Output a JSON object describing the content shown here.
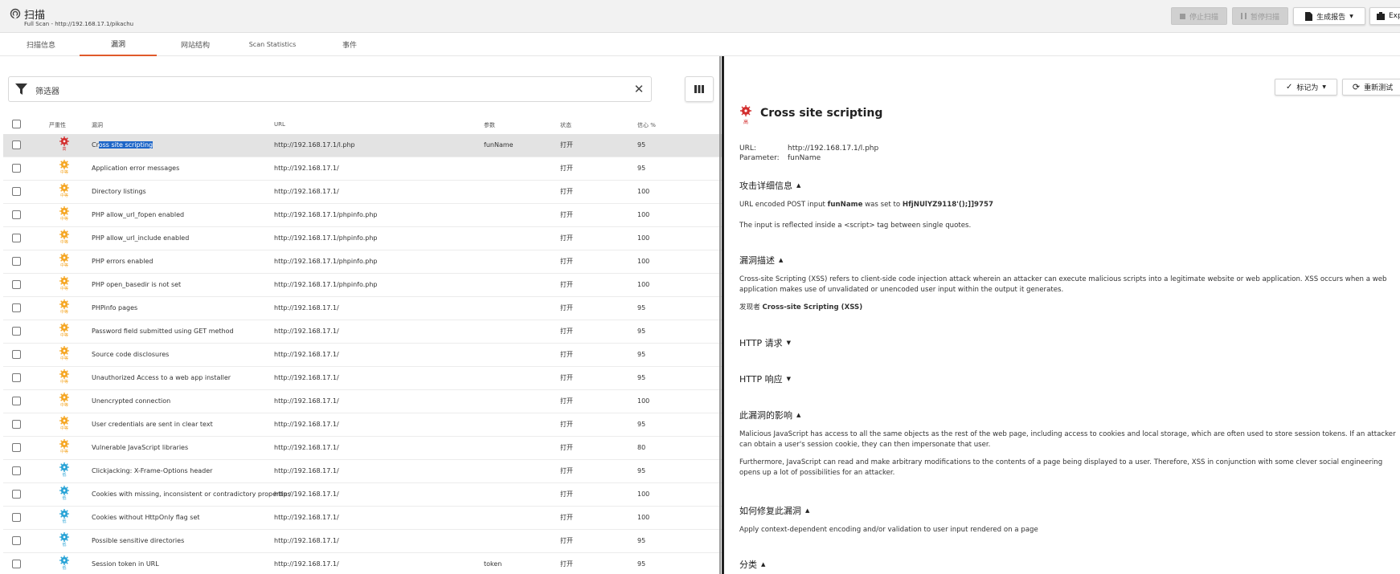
{
  "header": {
    "title": "扫描",
    "subtitle": "Full Scan - http://192.168.17.1/pikachu",
    "stop_label": "停止扫描",
    "pause_label": "暂停扫描",
    "report_label": "生成报告",
    "export_label": "Exp"
  },
  "tabs": [
    {
      "label": "扫描信息"
    },
    {
      "label": "漏洞"
    },
    {
      "label": "网站结构"
    },
    {
      "label": "Scan Statistics"
    },
    {
      "label": "事件"
    }
  ],
  "filter": {
    "label": "筛选器"
  },
  "columns": {
    "severity": "严重性",
    "vuln": "漏洞",
    "url": "URL",
    "param": "参数",
    "status": "状态",
    "confidence": "信心 %"
  },
  "severity_colors": {
    "high": "#d32f2f",
    "medium": "#f5a623",
    "low": "#29a3d6"
  },
  "rows": [
    {
      "sev": "high",
      "sev_label": "高",
      "name_pre": "Cr",
      "name_hl": "oss site scripting",
      "url": "http://192.168.17.1/l.php",
      "param": "funName",
      "status": "打开",
      "confidence": "95"
    },
    {
      "sev": "medium",
      "sev_label": "中等",
      "name_pre": "Application error messages",
      "name_hl": "",
      "url": "http://192.168.17.1/",
      "param": "",
      "status": "打开",
      "confidence": "95"
    },
    {
      "sev": "medium",
      "sev_label": "中等",
      "name_pre": "Directory listings",
      "name_hl": "",
      "url": "http://192.168.17.1/",
      "param": "",
      "status": "打开",
      "confidence": "100"
    },
    {
      "sev": "medium",
      "sev_label": "中等",
      "name_pre": "PHP allow_url_fopen enabled",
      "name_hl": "",
      "url": "http://192.168.17.1/phpinfo.php",
      "param": "",
      "status": "打开",
      "confidence": "100"
    },
    {
      "sev": "medium",
      "sev_label": "中等",
      "name_pre": "PHP allow_url_include enabled",
      "name_hl": "",
      "url": "http://192.168.17.1/phpinfo.php",
      "param": "",
      "status": "打开",
      "confidence": "100"
    },
    {
      "sev": "medium",
      "sev_label": "中等",
      "name_pre": "PHP errors enabled",
      "name_hl": "",
      "url": "http://192.168.17.1/phpinfo.php",
      "param": "",
      "status": "打开",
      "confidence": "100"
    },
    {
      "sev": "medium",
      "sev_label": "中等",
      "name_pre": "PHP open_basedir is not set",
      "name_hl": "",
      "url": "http://192.168.17.1/phpinfo.php",
      "param": "",
      "status": "打开",
      "confidence": "100"
    },
    {
      "sev": "medium",
      "sev_label": "中等",
      "name_pre": "PHPinfo pages",
      "name_hl": "",
      "url": "http://192.168.17.1/",
      "param": "",
      "status": "打开",
      "confidence": "95"
    },
    {
      "sev": "medium",
      "sev_label": "中等",
      "name_pre": "Password field submitted using GET method",
      "name_hl": "",
      "url": "http://192.168.17.1/",
      "param": "",
      "status": "打开",
      "confidence": "95"
    },
    {
      "sev": "medium",
      "sev_label": "中等",
      "name_pre": "Source code disclosures",
      "name_hl": "",
      "url": "http://192.168.17.1/",
      "param": "",
      "status": "打开",
      "confidence": "95"
    },
    {
      "sev": "medium",
      "sev_label": "中等",
      "name_pre": "Unauthorized Access to a web app installer",
      "name_hl": "",
      "url": "http://192.168.17.1/",
      "param": "",
      "status": "打开",
      "confidence": "95"
    },
    {
      "sev": "medium",
      "sev_label": "中等",
      "name_pre": "Unencrypted connection",
      "name_hl": "",
      "url": "http://192.168.17.1/",
      "param": "",
      "status": "打开",
      "confidence": "100"
    },
    {
      "sev": "medium",
      "sev_label": "中等",
      "name_pre": "User credentials are sent in clear text",
      "name_hl": "",
      "url": "http://192.168.17.1/",
      "param": "",
      "status": "打开",
      "confidence": "95"
    },
    {
      "sev": "medium",
      "sev_label": "中等",
      "name_pre": "Vulnerable JavaScript libraries",
      "name_hl": "",
      "url": "http://192.168.17.1/",
      "param": "",
      "status": "打开",
      "confidence": "80"
    },
    {
      "sev": "low",
      "sev_label": "低",
      "name_pre": "Clickjacking: X-Frame-Options header",
      "name_hl": "",
      "url": "http://192.168.17.1/",
      "param": "",
      "status": "打开",
      "confidence": "95"
    },
    {
      "sev": "low",
      "sev_label": "低",
      "name_pre": "Cookies with missing, inconsistent or contradictory properties",
      "name_hl": "",
      "url": "http://192.168.17.1/",
      "param": "",
      "status": "打开",
      "confidence": "100"
    },
    {
      "sev": "low",
      "sev_label": "低",
      "name_pre": "Cookies without HttpOnly flag set",
      "name_hl": "",
      "url": "http://192.168.17.1/",
      "param": "",
      "status": "打开",
      "confidence": "100"
    },
    {
      "sev": "low",
      "sev_label": "低",
      "name_pre": "Possible sensitive directories",
      "name_hl": "",
      "url": "http://192.168.17.1/",
      "param": "",
      "status": "打开",
      "confidence": "95"
    },
    {
      "sev": "low",
      "sev_label": "低",
      "name_pre": "Session token in URL",
      "name_hl": "",
      "url": "http://192.168.17.1/",
      "param": "token",
      "status": "打开",
      "confidence": "95"
    }
  ],
  "detail": {
    "mark_label": "标记为",
    "retest_label": "重新测试",
    "title": "Cross site scripting",
    "sev_label": "高",
    "url_label": "URL:",
    "url_value": "http://192.168.17.1/l.php",
    "param_label": "Parameter:",
    "param_value": "funName",
    "attack_title": "攻击详细信息",
    "attack_pre": "URL encoded POST input ",
    "attack_bold1": "funName",
    "attack_mid": " was set to ",
    "attack_bold2": "HfjNUlYZ9118'();]]9757",
    "attack_note": "The input is reflected inside a <script> tag between single quotes.",
    "desc_title": "漏洞描述",
    "desc_text": "Cross-site Scripting (XSS) refers to client-side code injection attack wherein an attacker can execute malicious scripts into a legitimate website or web application. XSS occurs when a web application makes use of unvalidated or unencoded user input within the output it generates.",
    "found_pre": "发现者 ",
    "found_by": "Cross-site Scripting (XSS)",
    "req_title": "HTTP 请求",
    "resp_title": "HTTP 响应",
    "impact_title": "此漏洞的影响",
    "impact_text1": "Malicious JavaScript has access to all the same objects as the rest of the web page, including access to cookies and local storage, which are often used to store session tokens. If an attacker can obtain a user's session cookie, they can then impersonate that user.",
    "impact_text2": "Furthermore, JavaScript can read and make arbitrary modifications to the contents of a page being displayed to a user. Therefore, XSS in conjunction with some clever social engineering opens up a lot of possibilities for an attacker.",
    "fix_title": "如何修复此漏洞",
    "fix_text": "Apply context-dependent encoding and/or validation to user input rendered on a page",
    "class_title": "分类"
  }
}
